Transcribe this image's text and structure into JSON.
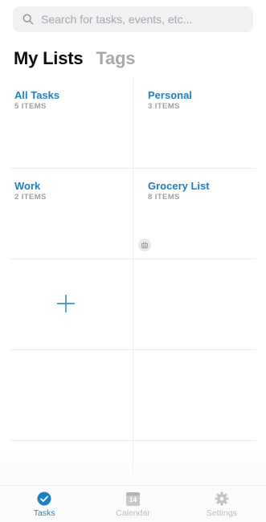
{
  "search": {
    "placeholder": "Search for tasks, events, etc...",
    "icon": "search-icon"
  },
  "header": {
    "active_tab": "My Lists",
    "inactive_tab": "Tags"
  },
  "lists": [
    {
      "name": "All Tasks",
      "count": "5 ITEMS"
    },
    {
      "name": "Personal",
      "count": "3 ITEMS"
    },
    {
      "name": "Work",
      "count": "2 ITEMS"
    },
    {
      "name": "Grocery List",
      "count": "8 ITEMS",
      "icon": "basket-icon"
    }
  ],
  "add_list": {
    "icon": "plus-icon"
  },
  "tabbar": {
    "items": [
      {
        "label": "Tasks",
        "icon": "check-circle-icon",
        "active": true
      },
      {
        "label": "Calendar",
        "icon": "calendar-icon",
        "day": "14",
        "active": false
      },
      {
        "label": "Settings",
        "icon": "gear-icon",
        "active": false
      }
    ]
  },
  "colors": {
    "accent": "#1f7fc4",
    "muted": "#a9a9ad",
    "divider": "#ececee"
  }
}
